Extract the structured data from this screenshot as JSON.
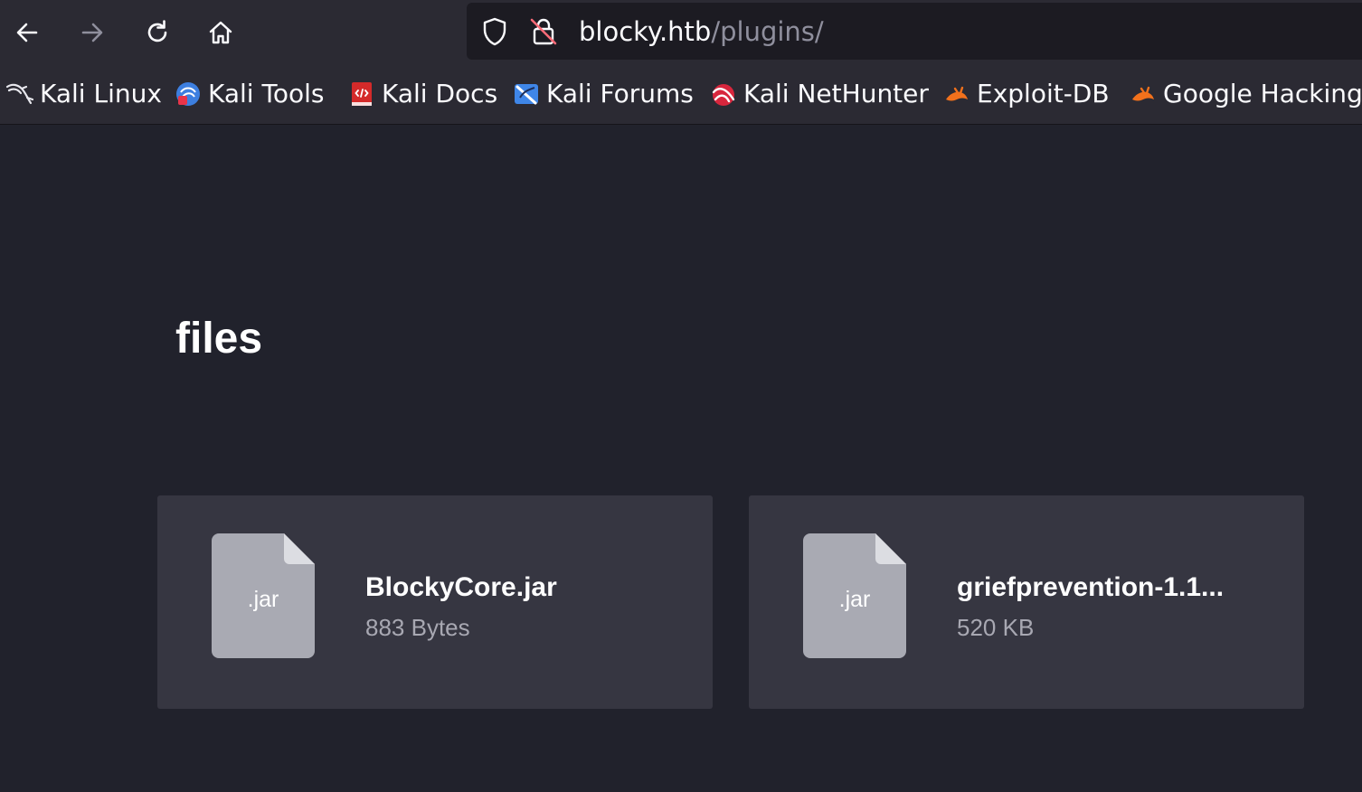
{
  "browser": {
    "url_host": "blocky.htb",
    "url_path": "/plugins/",
    "bookmarks": [
      {
        "label": "Kali Linux",
        "icon": "kali-dragon-icon"
      },
      {
        "label": "Kali Tools",
        "icon": "kali-tools-icon"
      },
      {
        "label": "Kali Docs",
        "icon": "kali-docs-icon"
      },
      {
        "label": "Kali Forums",
        "icon": "kali-forums-icon"
      },
      {
        "label": "Kali NetHunter",
        "icon": "kali-nethunter-icon"
      },
      {
        "label": "Exploit-DB",
        "icon": "exploit-db-icon"
      },
      {
        "label": "Google Hacking",
        "icon": "google-hacking-icon"
      }
    ]
  },
  "page": {
    "title": "files",
    "files": [
      {
        "ext": ".jar",
        "name": "BlockyCore.jar",
        "size": "883 Bytes"
      },
      {
        "ext": ".jar",
        "name": "griefprevention-1.1...",
        "size": "520 KB"
      }
    ]
  },
  "colors": {
    "background": "#21222c",
    "card": "#363641",
    "file_icon": "#a9aab3"
  }
}
